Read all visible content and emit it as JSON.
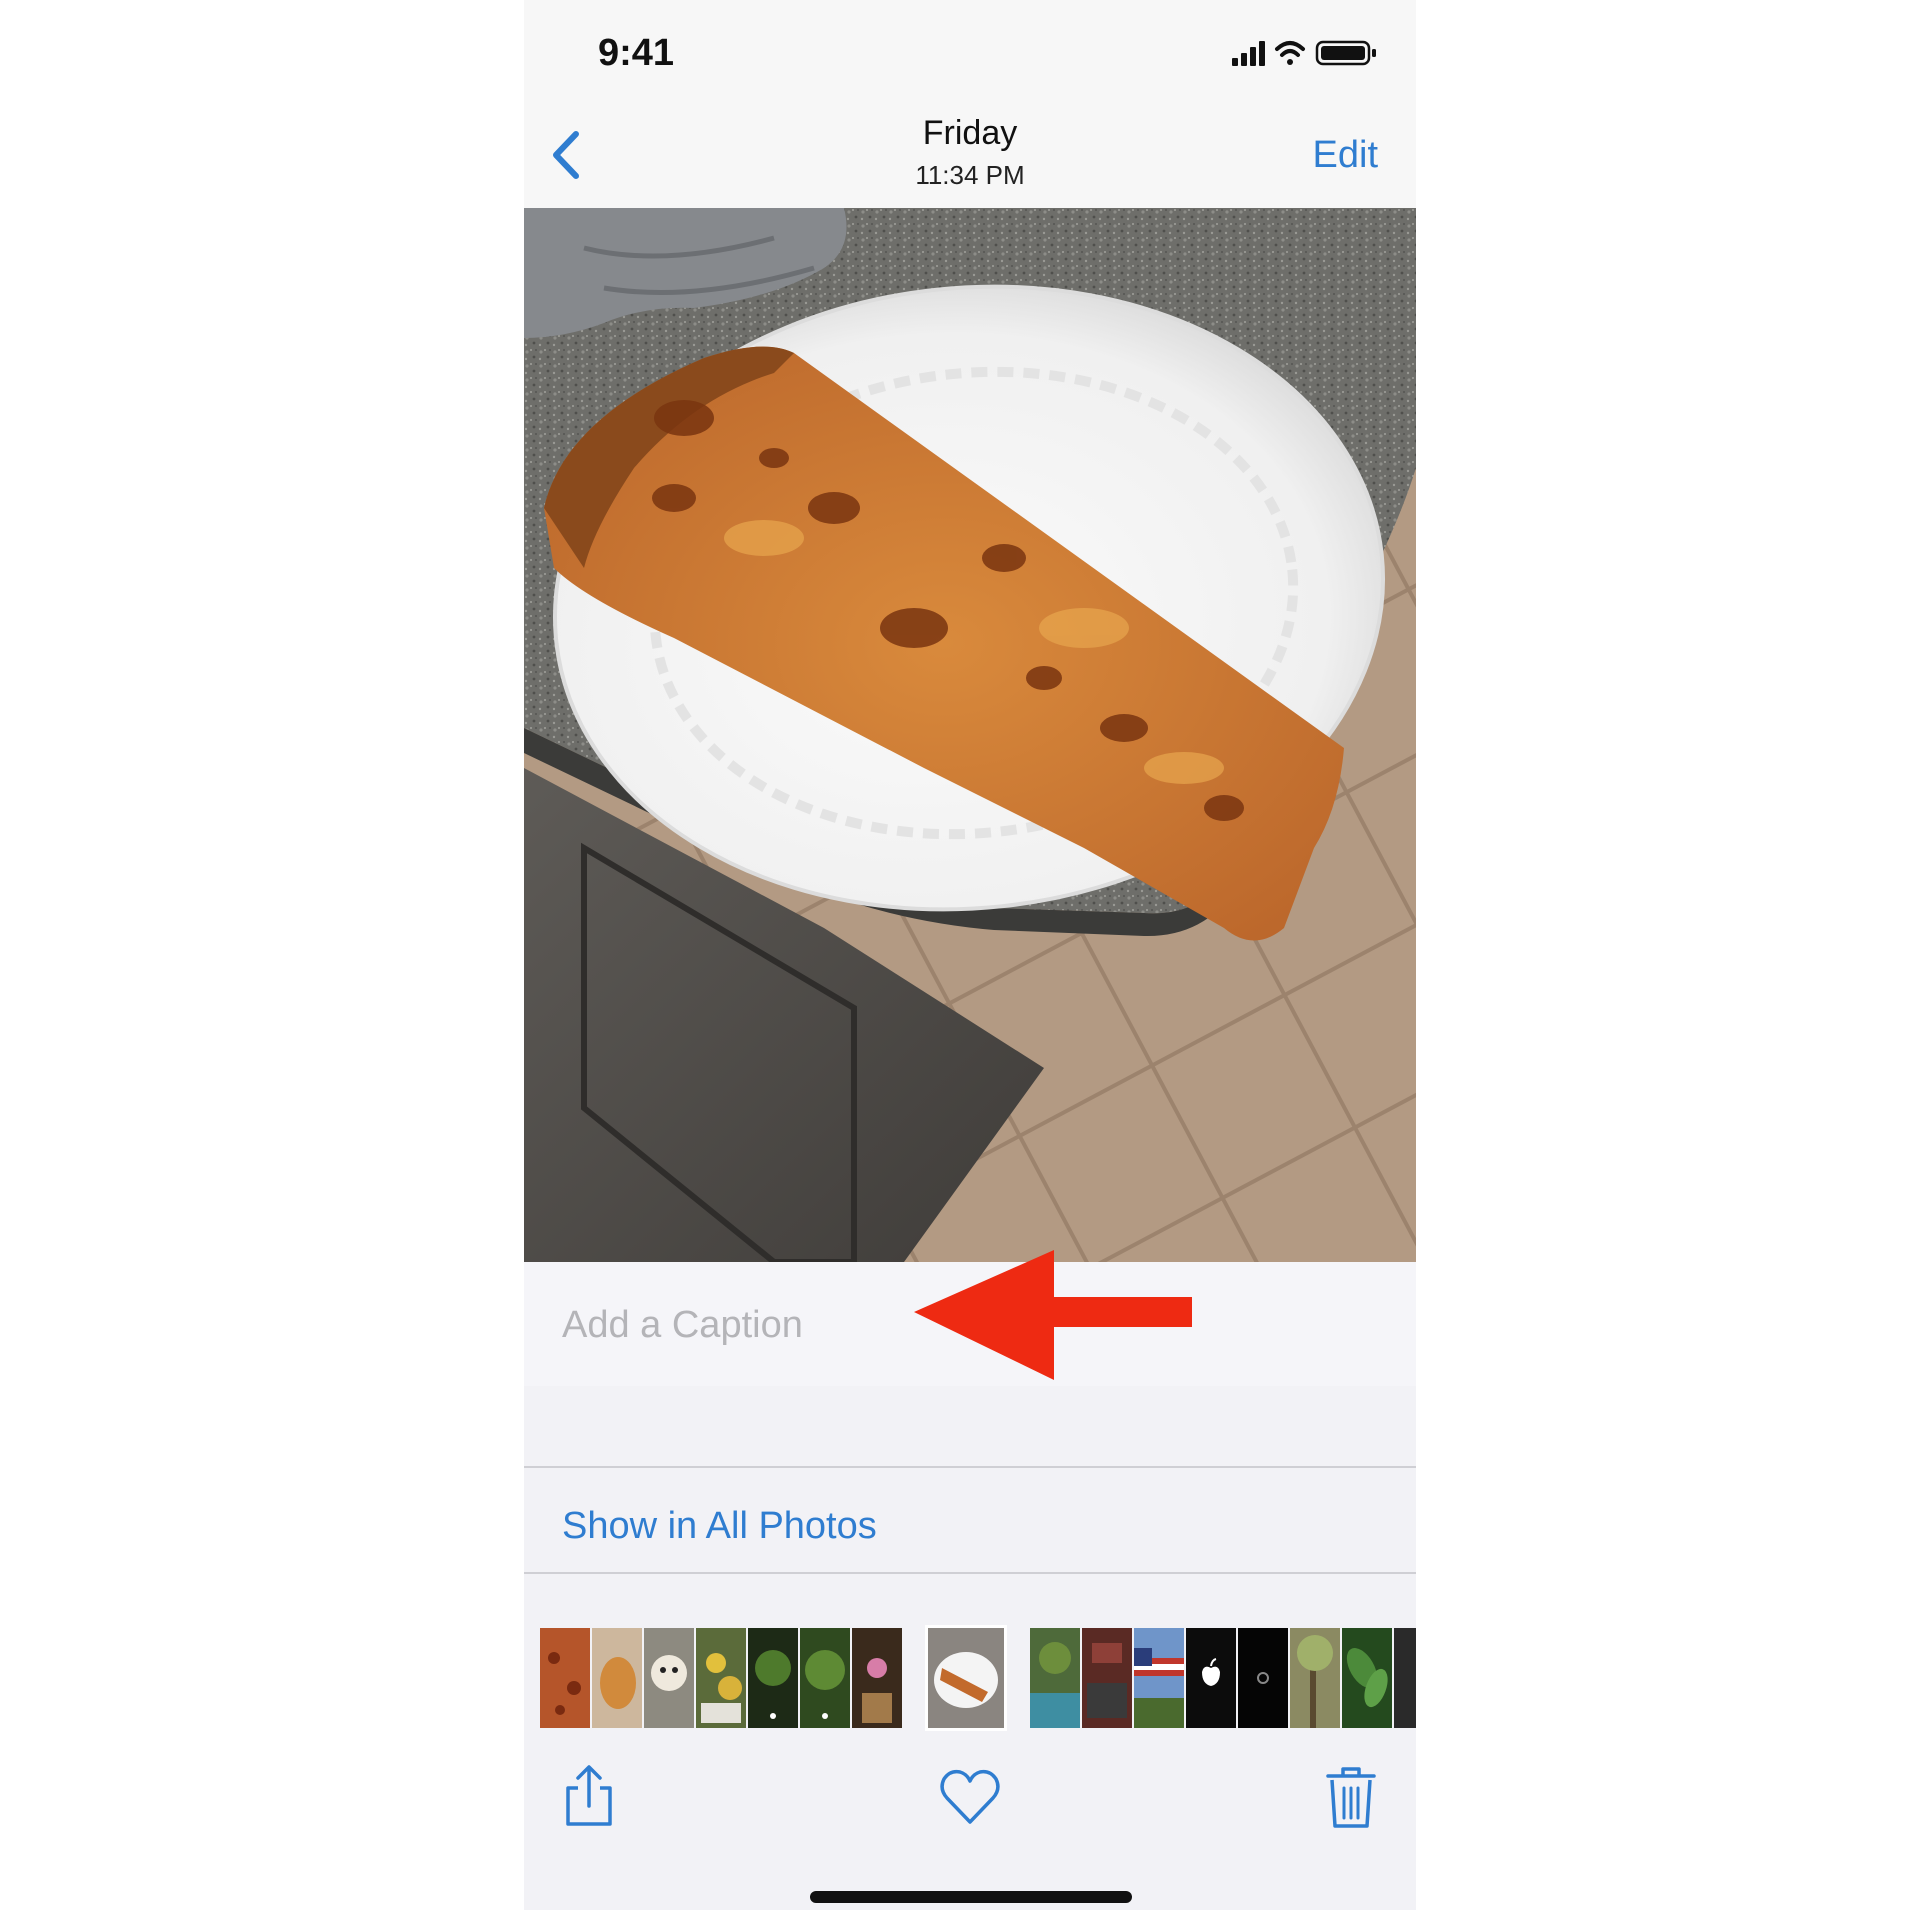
{
  "status_bar": {
    "time": "9:41",
    "icons": [
      "cellular-signal-icon",
      "wifi-icon",
      "battery-icon"
    ]
  },
  "nav": {
    "back_icon": "chevron-left-icon",
    "title": "Friday",
    "subtitle": "11:34 PM",
    "edit_label": "Edit"
  },
  "photo": {
    "subject": "pizza-slice-on-paper-plate"
  },
  "caption": {
    "placeholder": "Add a Caption",
    "value": "",
    "annotation": "red-arrow-pointing-left"
  },
  "show_in_all_photos_label": "Show in All Photos",
  "toolbar": {
    "share_icon": "share-icon",
    "favorite_icon": "heart-icon",
    "delete_icon": "trash-icon"
  },
  "colors": {
    "accent": "#2f7dd0",
    "annotation_red": "#ee2a12",
    "background": "#f2f2f6"
  }
}
